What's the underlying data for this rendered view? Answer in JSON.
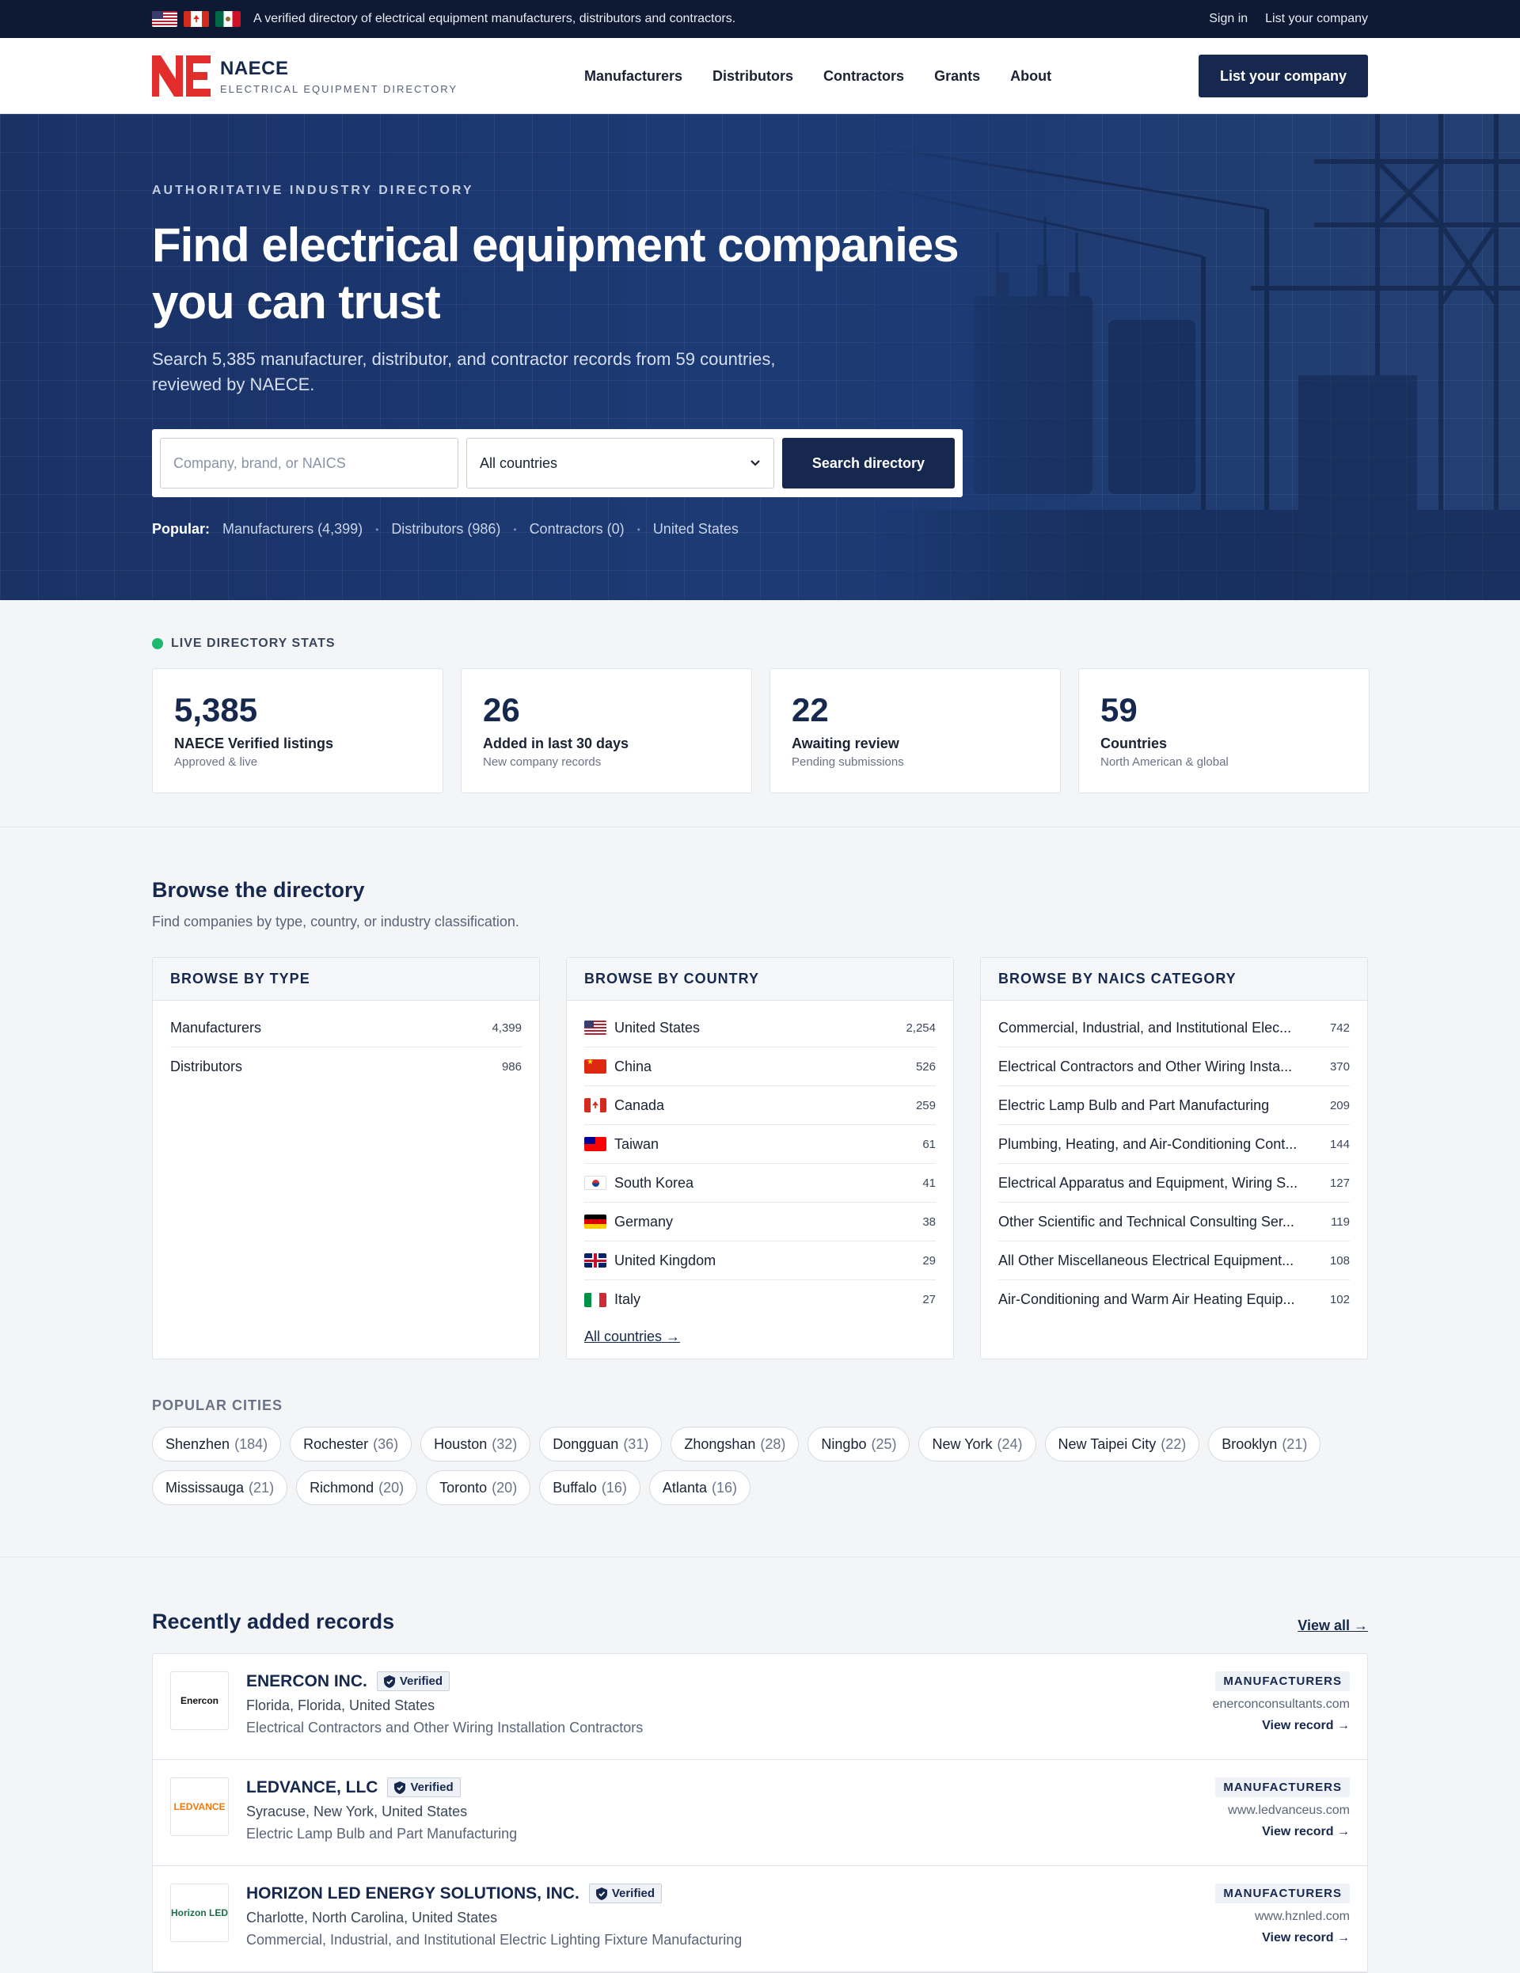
{
  "topbar": {
    "message": "A verified directory of electrical equipment manufacturers, distributors and contractors.",
    "sign_in": "Sign in",
    "list_company": "List your company"
  },
  "header": {
    "brand": "NAECE",
    "tagline": "ELECTRICAL EQUIPMENT DIRECTORY",
    "nav": [
      "Manufacturers",
      "Distributors",
      "Contractors",
      "Grants",
      "About"
    ],
    "cta": "List your company"
  },
  "hero": {
    "eyebrow": "AUTHORITATIVE INDUSTRY DIRECTORY",
    "title": "Find electrical equipment companies you can trust",
    "lead": "Search 5,385 manufacturer, distributor, and contractor records from 59 countries, reviewed by NAECE.",
    "search_placeholder": "Company, brand, or NAICS",
    "country_value": "All countries",
    "search_button": "Search directory",
    "popular_label": "Popular:",
    "popular": [
      "Manufacturers (4,399)",
      "Distributors (986)",
      "Contractors (0)",
      "United States"
    ]
  },
  "stats": {
    "label": "LIVE DIRECTORY STATS",
    "items": [
      {
        "num": "5,385",
        "title": "NAECE Verified listings",
        "sub": "Approved & live"
      },
      {
        "num": "26",
        "title": "Added in last 30 days",
        "sub": "New company records"
      },
      {
        "num": "22",
        "title": "Awaiting review",
        "sub": "Pending submissions"
      },
      {
        "num": "59",
        "title": "Countries",
        "sub": "North American & global"
      }
    ]
  },
  "browse": {
    "title": "Browse the directory",
    "subtitle": "Find companies by type, country, or industry classification.",
    "by_type": {
      "head": "BROWSE BY TYPE",
      "items": [
        {
          "name": "Manufacturers",
          "count": "4,399"
        },
        {
          "name": "Distributors",
          "count": "986"
        }
      ]
    },
    "by_country": {
      "head": "BROWSE BY COUNTRY",
      "items": [
        {
          "name": "United States",
          "count": "2,254",
          "flag": "us"
        },
        {
          "name": "China",
          "count": "526",
          "flag": "cn"
        },
        {
          "name": "Canada",
          "count": "259",
          "flag": "ca"
        },
        {
          "name": "Taiwan",
          "count": "61",
          "flag": "tw"
        },
        {
          "name": "South Korea",
          "count": "41",
          "flag": "kr"
        },
        {
          "name": "Germany",
          "count": "38",
          "flag": "de"
        },
        {
          "name": "United Kingdom",
          "count": "29",
          "flag": "gb"
        },
        {
          "name": "Italy",
          "count": "27",
          "flag": "it"
        }
      ],
      "all_link": "All countries →"
    },
    "by_naics": {
      "head": "BROWSE BY NAICS CATEGORY",
      "items": [
        {
          "name": "Commercial, Industrial, and Institutional Elec...",
          "count": "742"
        },
        {
          "name": "Electrical Contractors and Other Wiring Insta...",
          "count": "370"
        },
        {
          "name": "Electric Lamp Bulb and Part Manufacturing",
          "count": "209"
        },
        {
          "name": "Plumbing, Heating, and Air-Conditioning Cont...",
          "count": "144"
        },
        {
          "name": "Electrical Apparatus and Equipment, Wiring S...",
          "count": "127"
        },
        {
          "name": "Other Scientific and Technical Consulting Ser...",
          "count": "119"
        },
        {
          "name": "All Other Miscellaneous Electrical Equipment...",
          "count": "108"
        },
        {
          "name": "Air-Conditioning and Warm Air Heating Equip...",
          "count": "102"
        }
      ]
    },
    "cities_label": "POPULAR CITIES",
    "cities": [
      {
        "name": "Shenzhen",
        "count": "(184)"
      },
      {
        "name": "Rochester",
        "count": "(36)"
      },
      {
        "name": "Houston",
        "count": "(32)"
      },
      {
        "name": "Dongguan",
        "count": "(31)"
      },
      {
        "name": "Zhongshan",
        "count": "(28)"
      },
      {
        "name": "Ningbo",
        "count": "(25)"
      },
      {
        "name": "New York",
        "count": "(24)"
      },
      {
        "name": "New Taipei City",
        "count": "(22)"
      },
      {
        "name": "Brooklyn",
        "count": "(21)"
      },
      {
        "name": "Mississauga",
        "count": "(21)"
      },
      {
        "name": "Richmond",
        "count": "(20)"
      },
      {
        "name": "Toronto",
        "count": "(20)"
      },
      {
        "name": "Buffalo",
        "count": "(16)"
      },
      {
        "name": "Atlanta",
        "count": "(16)"
      }
    ]
  },
  "recent": {
    "title": "Recently added records",
    "view_all": "View all →",
    "verified": "Verified",
    "view_record": "View record →",
    "records": [
      {
        "name": "ENERCON INC.",
        "logo": "Enercon",
        "logo_color": "#111111",
        "location": "Florida, Florida, United States",
        "category": "Electrical Contractors and Other Wiring Installation Contractors",
        "type": "MANUFACTURERS",
        "website": "enerconconsultants.com"
      },
      {
        "name": "LEDVANCE, LLC",
        "logo": "LEDVANCE",
        "logo_color": "#f2790d",
        "location": "Syracuse, New York, United States",
        "category": "Electric Lamp Bulb and Part Manufacturing",
        "type": "MANUFACTURERS",
        "website": "www.ledvanceus.com"
      },
      {
        "name": "HORIZON LED ENERGY SOLUTIONS, INC.",
        "logo": "Horizon LED",
        "logo_color": "#1b6e4a",
        "location": "Charlotte, North Carolina, United States",
        "category": "Commercial, Industrial, and Institutional Electric Lighting Fixture Manufacturing",
        "type": "MANUFACTURERS",
        "website": "www.hznled.com"
      }
    ]
  }
}
